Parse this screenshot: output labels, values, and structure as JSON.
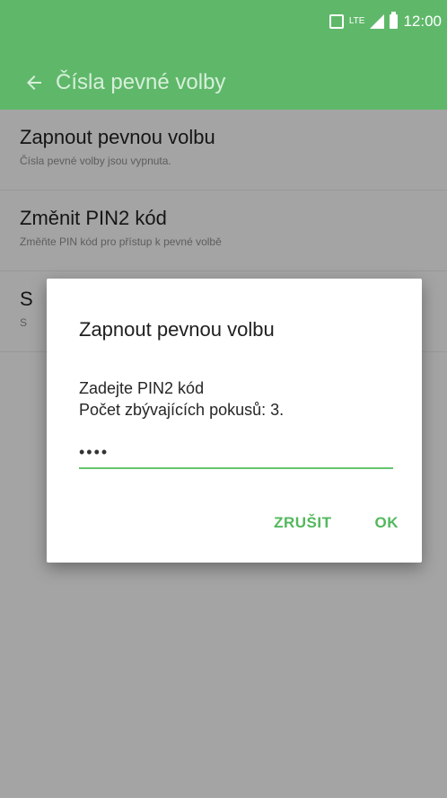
{
  "status_bar": {
    "nfc_icon": "nfc-icon",
    "network_label": "LTE",
    "signal_icon": "signal-icon",
    "battery_icon": "battery-icon",
    "time": "12:00"
  },
  "appbar": {
    "back_icon": "back-arrow-icon",
    "title": "Čísla pevné volby"
  },
  "settings": {
    "items": [
      {
        "title": "Zapnout pevnou volbu",
        "subtitle": "Čísla pevné volby jsou vypnuta."
      },
      {
        "title": "Změnit PIN2 kód",
        "subtitle": "Změňte PIN kód pro přístup k pevné volbě"
      },
      {
        "title": "S",
        "subtitle": "S"
      }
    ]
  },
  "dialog": {
    "title": "Zapnout pevnou volbu",
    "message_line1": "Zadejte PIN2 kód",
    "message_line2": "Počet zbývajících pokusů: 3.",
    "pin_value": "••••",
    "cancel_label": "ZRUŠIT",
    "ok_label": "OK"
  },
  "colors": {
    "accent": "#5fb86a",
    "dialog_button": "#53b85d",
    "input_underline": "#63c46e"
  }
}
